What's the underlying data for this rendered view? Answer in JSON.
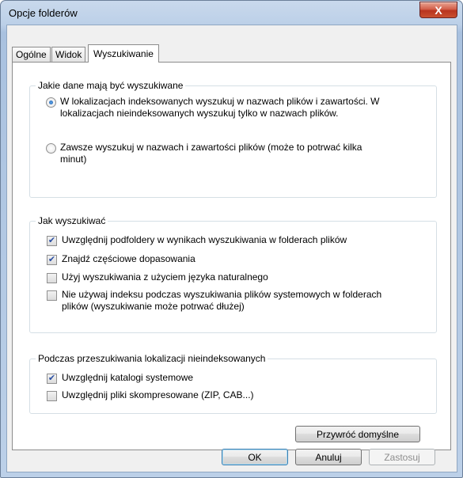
{
  "window": {
    "title": "Opcje folderów",
    "close_label": "X"
  },
  "tabs": [
    "Ogólne",
    "Widok",
    "Wyszukiwanie"
  ],
  "active_tab": "Wyszukiwanie",
  "group_search_what": {
    "title": "Jakie dane mają być wyszukiwane",
    "options": [
      {
        "label_line1": "W lokalizacjach indeksowanych wyszukuj w nazwach plików i zawartości. W",
        "label_line2": "lokalizacjach nieindeksowanych wyszukuj tylko w nazwach plików.",
        "selected": true
      },
      {
        "label_line1": "Zawsze wyszukuj w nazwach i zawartości plików (może to potrwać kilka",
        "label_line2": "minut)",
        "selected": false
      }
    ]
  },
  "group_how": {
    "title": "Jak wyszukiwać",
    "options": [
      {
        "label_line1": "Uwzględnij podfoldery w wynikach wyszukiwania w folderach plików",
        "label_line2": "",
        "checked": true
      },
      {
        "label_line1": "Znajdź częściowe dopasowania",
        "label_line2": "",
        "checked": true
      },
      {
        "label_line1": "Użyj wyszukiwania z użyciem języka naturalnego",
        "label_line2": "",
        "checked": false
      },
      {
        "label_line1": "Nie używaj indeksu podczas wyszukiwania plików systemowych w folderach",
        "label_line2": "plików (wyszukiwanie może potrwać dłużej)",
        "checked": false
      }
    ]
  },
  "group_nonindexed": {
    "title": "Podczas przeszukiwania lokalizacji nieindeksowanych",
    "options": [
      {
        "label_line1": "Uwzględnij katalogi systemowe",
        "checked": true
      },
      {
        "label_line1": "Uwzględnij pliki skompresowane (ZIP, CAB...)",
        "checked": false
      }
    ]
  },
  "buttons": {
    "restore_defaults": "Przywróć domyślne",
    "ok": "OK",
    "cancel": "Anuluj",
    "apply": "Zastosuj"
  },
  "check_mark": "✔"
}
